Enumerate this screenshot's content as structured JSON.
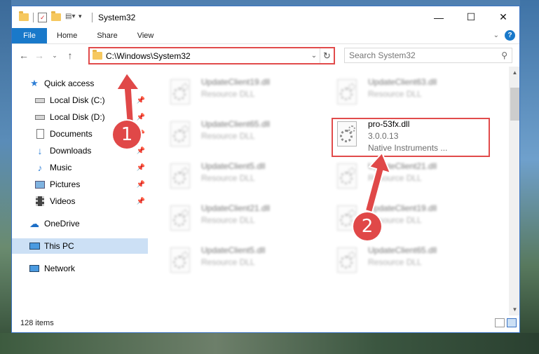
{
  "window": {
    "title": "System32",
    "controls": {
      "minimize": "—",
      "maximize": "☐",
      "close": "✕"
    }
  },
  "ribbon": {
    "tabs": [
      {
        "label": "File"
      },
      {
        "label": "Home"
      },
      {
        "label": "Share"
      },
      {
        "label": "View"
      }
    ]
  },
  "nav": {
    "address": "C:\\Windows\\System32",
    "search_placeholder": "Search System32"
  },
  "sidebar": {
    "items": [
      {
        "label": "Quick access",
        "icon": "star-icon",
        "pinned": false
      },
      {
        "label": "Local Disk (C:)",
        "icon": "drive-icon",
        "pinned": true
      },
      {
        "label": "Local Disk (D:)",
        "icon": "drive-icon",
        "pinned": true
      },
      {
        "label": "Documents",
        "icon": "documents-icon",
        "pinned": true
      },
      {
        "label": "Downloads",
        "icon": "download-icon",
        "pinned": true
      },
      {
        "label": "Music",
        "icon": "music-icon",
        "pinned": true
      },
      {
        "label": "Pictures",
        "icon": "pictures-icon",
        "pinned": true
      },
      {
        "label": "Videos",
        "icon": "videos-icon",
        "pinned": true
      },
      {
        "label": "OneDrive",
        "icon": "onedrive-icon",
        "pinned": false
      },
      {
        "label": "This PC",
        "icon": "pc-icon",
        "pinned": false,
        "selected": true
      },
      {
        "label": "Network",
        "icon": "network-icon",
        "pinned": false
      }
    ]
  },
  "files": [
    {
      "name": "UpdateClient19.dll",
      "sub": "Resource DLL",
      "blurred": true
    },
    {
      "name": "UpdateClient63.dll",
      "sub": "Resource DLL",
      "blurred": true
    },
    {
      "name": "UpdateClient65.dll",
      "sub": "Resource DLL",
      "blurred": true
    },
    {
      "name": "pro-53fx.dll",
      "sub": "3.0.0.13",
      "sub2": "Native Instruments ...",
      "blurred": false
    },
    {
      "name": "UpdateClient5.dll",
      "sub": "Resource DLL",
      "blurred": true
    },
    {
      "name": "UpdateClient21.dll",
      "sub": "Resource DLL",
      "blurred": true
    },
    {
      "name": "UpdateClient21.dll",
      "sub": "Resource DLL",
      "blurred": true
    },
    {
      "name": "UpdateClient19.dll",
      "sub": "Resource DLL",
      "blurred": true
    },
    {
      "name": "UpdateClient5.dll",
      "sub": "Resource DLL",
      "blurred": true
    },
    {
      "name": "UpdateClient65.dll",
      "sub": "Resource DLL",
      "blurred": true
    }
  ],
  "status": {
    "item_count": "128 items"
  },
  "markers": {
    "one": "1",
    "two": "2"
  },
  "colors": {
    "accent": "#1979ca",
    "highlight": "#e14b4b",
    "selected": "#cce0f5"
  }
}
